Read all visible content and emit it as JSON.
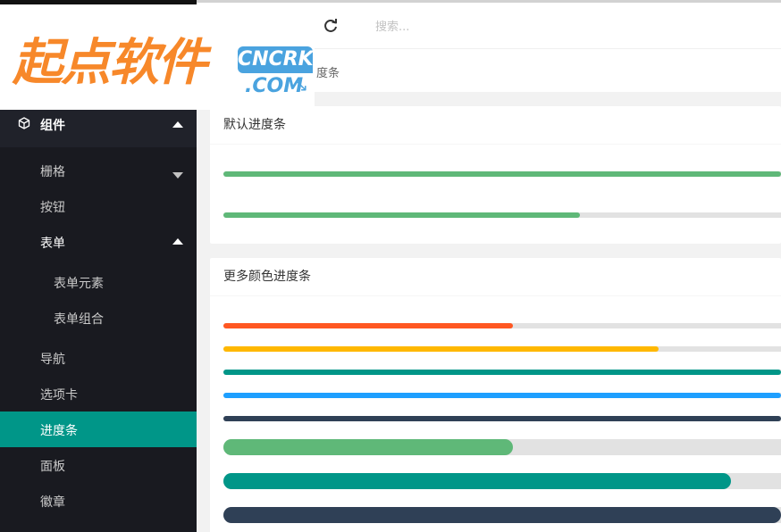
{
  "logo": {
    "text": "起点软件",
    "badge_top": "CNCRK",
    "badge_bottom": ".COM"
  },
  "header": {
    "refresh_icon": "refresh-icon",
    "search_placeholder": "搜索..."
  },
  "breadcrumb": {
    "current": "度条"
  },
  "sidebar": {
    "group": {
      "icon": "cube-icon",
      "label": "组件",
      "expanded": true
    },
    "items": [
      {
        "label": "栅格",
        "level": 1,
        "caret": "down"
      },
      {
        "label": "按钮",
        "level": 1
      },
      {
        "label": "表单",
        "level": 1,
        "caret": "up"
      },
      {
        "label": "表单元素",
        "level": 2
      },
      {
        "label": "表单组合",
        "level": 2
      },
      {
        "label": "导航",
        "level": 1
      },
      {
        "label": "选项卡",
        "level": 1
      },
      {
        "label": "进度条",
        "level": 1,
        "active": true
      },
      {
        "label": "面板",
        "level": 1
      },
      {
        "label": "徽章",
        "level": 1
      }
    ]
  },
  "cards": {
    "default": {
      "title": "默认进度条",
      "bars": [
        {
          "percent": 100,
          "color": "#5fb878"
        },
        {
          "percent": 64,
          "color": "#5fb878"
        }
      ]
    },
    "colors": {
      "title": "更多颜色进度条",
      "bars": [
        {
          "percent": 52,
          "color": "#ff5722"
        },
        {
          "percent": 78,
          "color": "#ffb800"
        },
        {
          "percent": 100,
          "color": "#009688"
        },
        {
          "percent": 100,
          "color": "#1e9fff"
        },
        {
          "percent": 100,
          "color": "#2f4056"
        },
        {
          "percent": 52,
          "color": "#5fb878"
        },
        {
          "percent": 91,
          "color": "#009688"
        },
        {
          "percent": 100,
          "color": "#2f4056"
        }
      ]
    }
  },
  "colors": {
    "active": "#009688",
    "sidebar": "#20222a",
    "sidebar_sub": "#191a20",
    "track": "#e2e2e2"
  }
}
